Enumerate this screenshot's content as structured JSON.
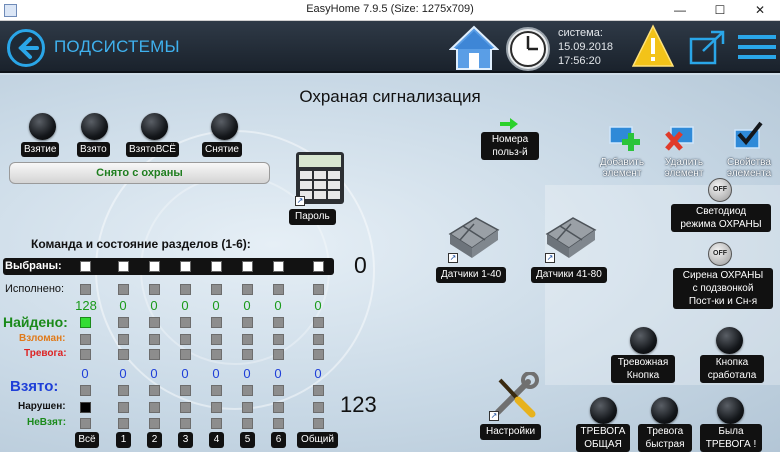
{
  "window": {
    "title": "EasyHome 7.9.5 (Size: 1275x709)"
  },
  "header": {
    "title": "ПОДСИСТЕМЫ",
    "sys_label": "системa:",
    "sys_date": "15.09.2018",
    "sys_time": "17:56:20"
  },
  "page": {
    "title": "Охраная сигнализация"
  },
  "arm_buttons": [
    {
      "label": "Взятие"
    },
    {
      "label": "Взято"
    },
    {
      "label": "ВзятоВСЁ"
    },
    {
      "label": "Снятие"
    }
  ],
  "status": {
    "text": "Снято с охраны"
  },
  "password": {
    "label": "Пароль"
  },
  "users": {
    "label": "Номера\nпольз-й"
  },
  "element_actions": [
    {
      "label": "Добавить\nэлемент"
    },
    {
      "label": "Удалить\nэлемент"
    },
    {
      "label": "Свойства\nэлемента"
    }
  ],
  "sections": {
    "heading": "Команда и состояние разделов (1-6):",
    "rows": {
      "selected": "Выбраны:",
      "done": "Исполнено:",
      "found": "Найдено:",
      "broken": "Взломан:",
      "alarm": "Тревога:",
      "armed": "Взято:",
      "violated": "Нарушен:",
      "not_armed": "НеВзят:"
    },
    "done_values": [
      "128",
      "0",
      "0",
      "0",
      "0",
      "0",
      "0",
      "0"
    ],
    "armed_values": [
      "0",
      "0",
      "0",
      "0",
      "0",
      "0",
      "0",
      "0"
    ],
    "columns": [
      "Всё",
      "1",
      "2",
      "3",
      "4",
      "5",
      "6",
      "Общий"
    ],
    "selected_count": "0",
    "code_value": "123"
  },
  "sensors": [
    {
      "label": "Датчики 1-40"
    },
    {
      "label": "Датчики 41-80"
    }
  ],
  "led": {
    "label": "Светодиод\nрежима ОХРАНЫ",
    "state": "OFF"
  },
  "siren": {
    "label": "Сирена ОХРАНЫ\nс подзвонкой\nПост-ки  и Сн-я",
    "state": "OFF"
  },
  "alarm_buttons": [
    {
      "label": "Тревожная\nКнопка"
    },
    {
      "label": "Кнопка\nсработала"
    }
  ],
  "settings": {
    "label": "Настройки"
  },
  "bottom_alarms": [
    {
      "label": "ТРЕВОГА\nОБЩАЯ"
    },
    {
      "label": "Тревога\nбыстрая"
    },
    {
      "label": "Была\nТРЕВОГА !"
    }
  ],
  "colors": {
    "header_bg": "#1f2833",
    "accent_blue": "#2aa6e8",
    "status_green": "#1f7e1f",
    "found_green": "#1a8a1a",
    "alarm_red": "#dd2222",
    "broken_orange": "#e07a1a",
    "armed_blue": "#1f3fd8"
  }
}
